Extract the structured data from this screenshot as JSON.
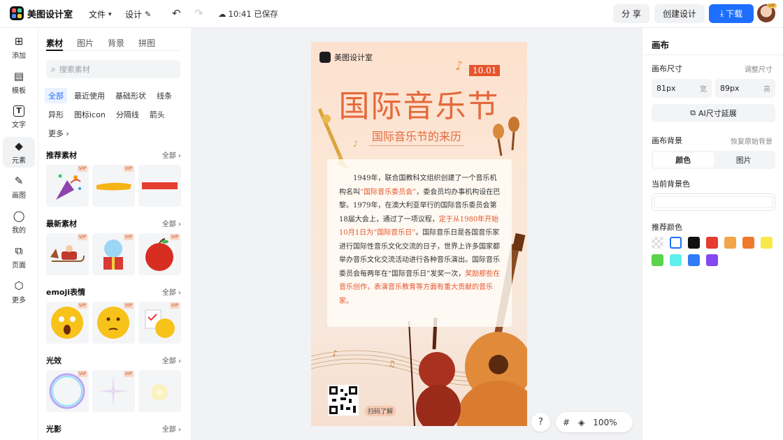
{
  "app": {
    "name": "美图设计室"
  },
  "topbar": {
    "file_menu": "文件",
    "design_menu": "设计",
    "save_status": "10:41 已保存",
    "share": "分 享",
    "create_design": "创建设计",
    "download": "下载",
    "vip_badge": "VIP"
  },
  "leftnav": {
    "items": [
      {
        "label": "添加",
        "icon": "add-square-icon"
      },
      {
        "label": "模板",
        "icon": "template-grid-icon"
      },
      {
        "label": "文字",
        "icon": "text-icon"
      },
      {
        "label": "元素",
        "icon": "element-shapes-icon"
      },
      {
        "label": "画图",
        "icon": "draw-pen-icon"
      },
      {
        "label": "我的",
        "icon": "user-icon"
      },
      {
        "label": "页面",
        "icon": "page-add-icon"
      },
      {
        "label": "更多",
        "icon": "cube-icon"
      }
    ],
    "active_index": 3
  },
  "materials": {
    "tabs": [
      "素材",
      "图片",
      "背景",
      "拼图"
    ],
    "active_tab": 0,
    "search_placeholder": "搜索素材",
    "chips": [
      "全部",
      "最近使用",
      "基础形状",
      "线条",
      "异形",
      "图标icon",
      "分隔线",
      "箭头",
      "更多"
    ],
    "active_chip": 0,
    "see_all": "全部",
    "sections": [
      {
        "title": "推荐素材",
        "items": [
          "party-popper",
          "yellow-brush-stroke",
          "red-bar"
        ]
      },
      {
        "title": "最新素材",
        "items": [
          "santa-sleigh",
          "snow-globe-gift",
          "red-apple"
        ]
      },
      {
        "title": "emoji表情",
        "items": [
          "shocked-emoji",
          "thinking-emoji",
          "checklist-emoji"
        ]
      },
      {
        "title": "光效",
        "items": [
          "bubble-ring",
          "sparkle-star",
          "soft-glow"
        ]
      },
      {
        "title": "光影",
        "items": []
      }
    ],
    "vip_label": "VIP"
  },
  "poster": {
    "brand": "美图设计室",
    "date": "10.01",
    "title": "国际音乐节",
    "subtitle": "国际音乐节的来历",
    "body_1": "1949年，联合国教科文组织创建了一个音乐机构名叫",
    "body_hl_1": "“国际音乐委员会”",
    "body_2": "，委会员均办事机构设在巴黎。1979年，在澳大利亚举行的国际音乐委员会第18届大会上，通过了一项议程，",
    "body_hl_2": "定于从1980年开始10月1日为“国际音乐日”",
    "body_3": "。国际音乐日是各国音乐家进行国际性音乐文化交流的日子，世界上许多国家都举办音乐文化交流活动进行各种音乐演出。国际音乐委员会每两年在“国际音乐日”发奖一次，",
    "body_hl_3": "奖励那些在音乐创作，表演音乐教育等方面有重大贡献的音乐家。",
    "qr_label": "扫码了解"
  },
  "canvas_tools": {
    "help": "?",
    "zoom": "100%"
  },
  "right": {
    "title": "画布",
    "size_label": "画布尺寸",
    "resize_link": "调整尺寸",
    "width_value": "81px",
    "width_unit": "宽",
    "height_value": "89px",
    "height_unit": "高",
    "ai_extend": "AI尺寸延展",
    "bg_label": "画布背景",
    "restore_bg": "恢复原始背景",
    "seg_color": "颜色",
    "seg_image": "图片",
    "current_bg_label": "当前背景色",
    "recommended_label": "推荐颜色",
    "swatches": [
      "transparent",
      "#ffffff",
      "#111111",
      "#e53d2f",
      "#f2a54a",
      "#f07a2b",
      "#f7e94a",
      "#58d449",
      "#5ef0ec",
      "#2f7cf6",
      "#8648f0"
    ]
  },
  "colors": {
    "accent": "#1e6fff",
    "poster_orange": "#e5693c",
    "poster_red": "#e5552c"
  }
}
